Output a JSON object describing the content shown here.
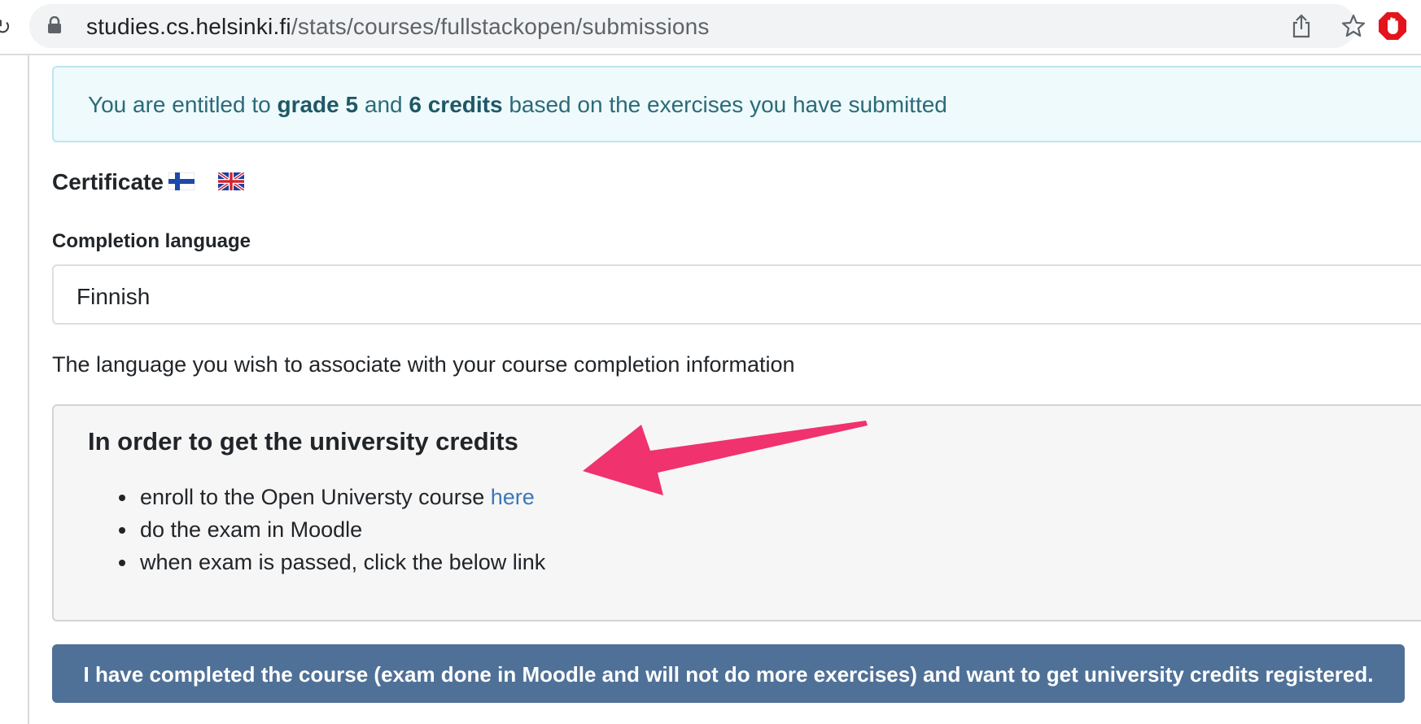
{
  "browser": {
    "url_host": "studies.cs.helsinki.fi",
    "url_path": "/stats/courses/fullstackopen/submissions",
    "icons": [
      "reload-icon",
      "lock-icon",
      "share-icon",
      "star-icon",
      "adblock-icon"
    ]
  },
  "grade_alert": {
    "prefix": "You are entitled to",
    "grade": "grade 5",
    "and": "and",
    "credits": "6 credits",
    "suffix": "based on the exercises you have submitted"
  },
  "certificate": {
    "label": "Certificate",
    "flags": [
      "finnish-flag-icon",
      "uk-flag-icon"
    ]
  },
  "completion_language": {
    "label": "Completion language",
    "selected": "Finnish",
    "help": "The language you wish to associate with your course completion information"
  },
  "credits_box": {
    "heading": "In order to get the university credits",
    "steps": [
      {
        "text": "enroll to the Open Universty course",
        "link": "here"
      },
      {
        "text": "do the exam in Moodle"
      },
      {
        "text": "when exam is passed, click the below link"
      }
    ]
  },
  "complete_button": {
    "label": "I have completed the course (exam done in Moodle and will not do more exercises) and want to get university credits registered."
  },
  "colors": {
    "alert_text": "#2c6a78",
    "link": "#3a78b8",
    "button_bg": "#4f7198",
    "arrow": "#f0326e"
  }
}
